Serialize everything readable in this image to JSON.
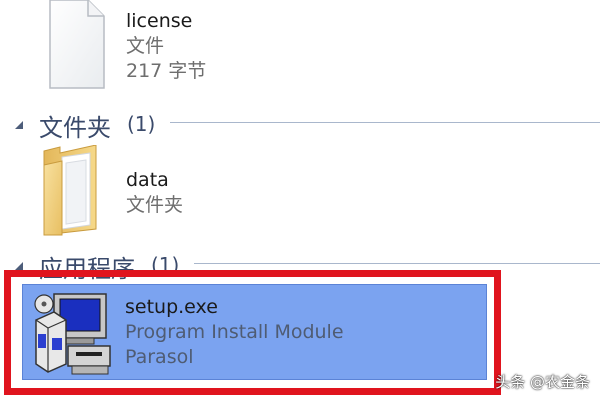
{
  "files": [
    {
      "name": "license",
      "type": "文件",
      "size": "217 字节",
      "icon": "document-icon"
    }
  ],
  "groups": [
    {
      "label": "文件夹",
      "count": "(1)",
      "items": [
        {
          "name": "data",
          "type": "文件夹",
          "icon": "folder-icon"
        }
      ]
    },
    {
      "label": "应用程序",
      "count": "(1)",
      "items": [
        {
          "name": "setup.exe",
          "description": "Program Install Module",
          "company": "Parasol",
          "icon": "setup-installer-icon",
          "selected": true
        }
      ]
    }
  ],
  "watermark": "头条 @农金条",
  "colors": {
    "selection": "#7ba3f0",
    "highlight": "#e0141e",
    "group_text": "#3a4a6b"
  }
}
